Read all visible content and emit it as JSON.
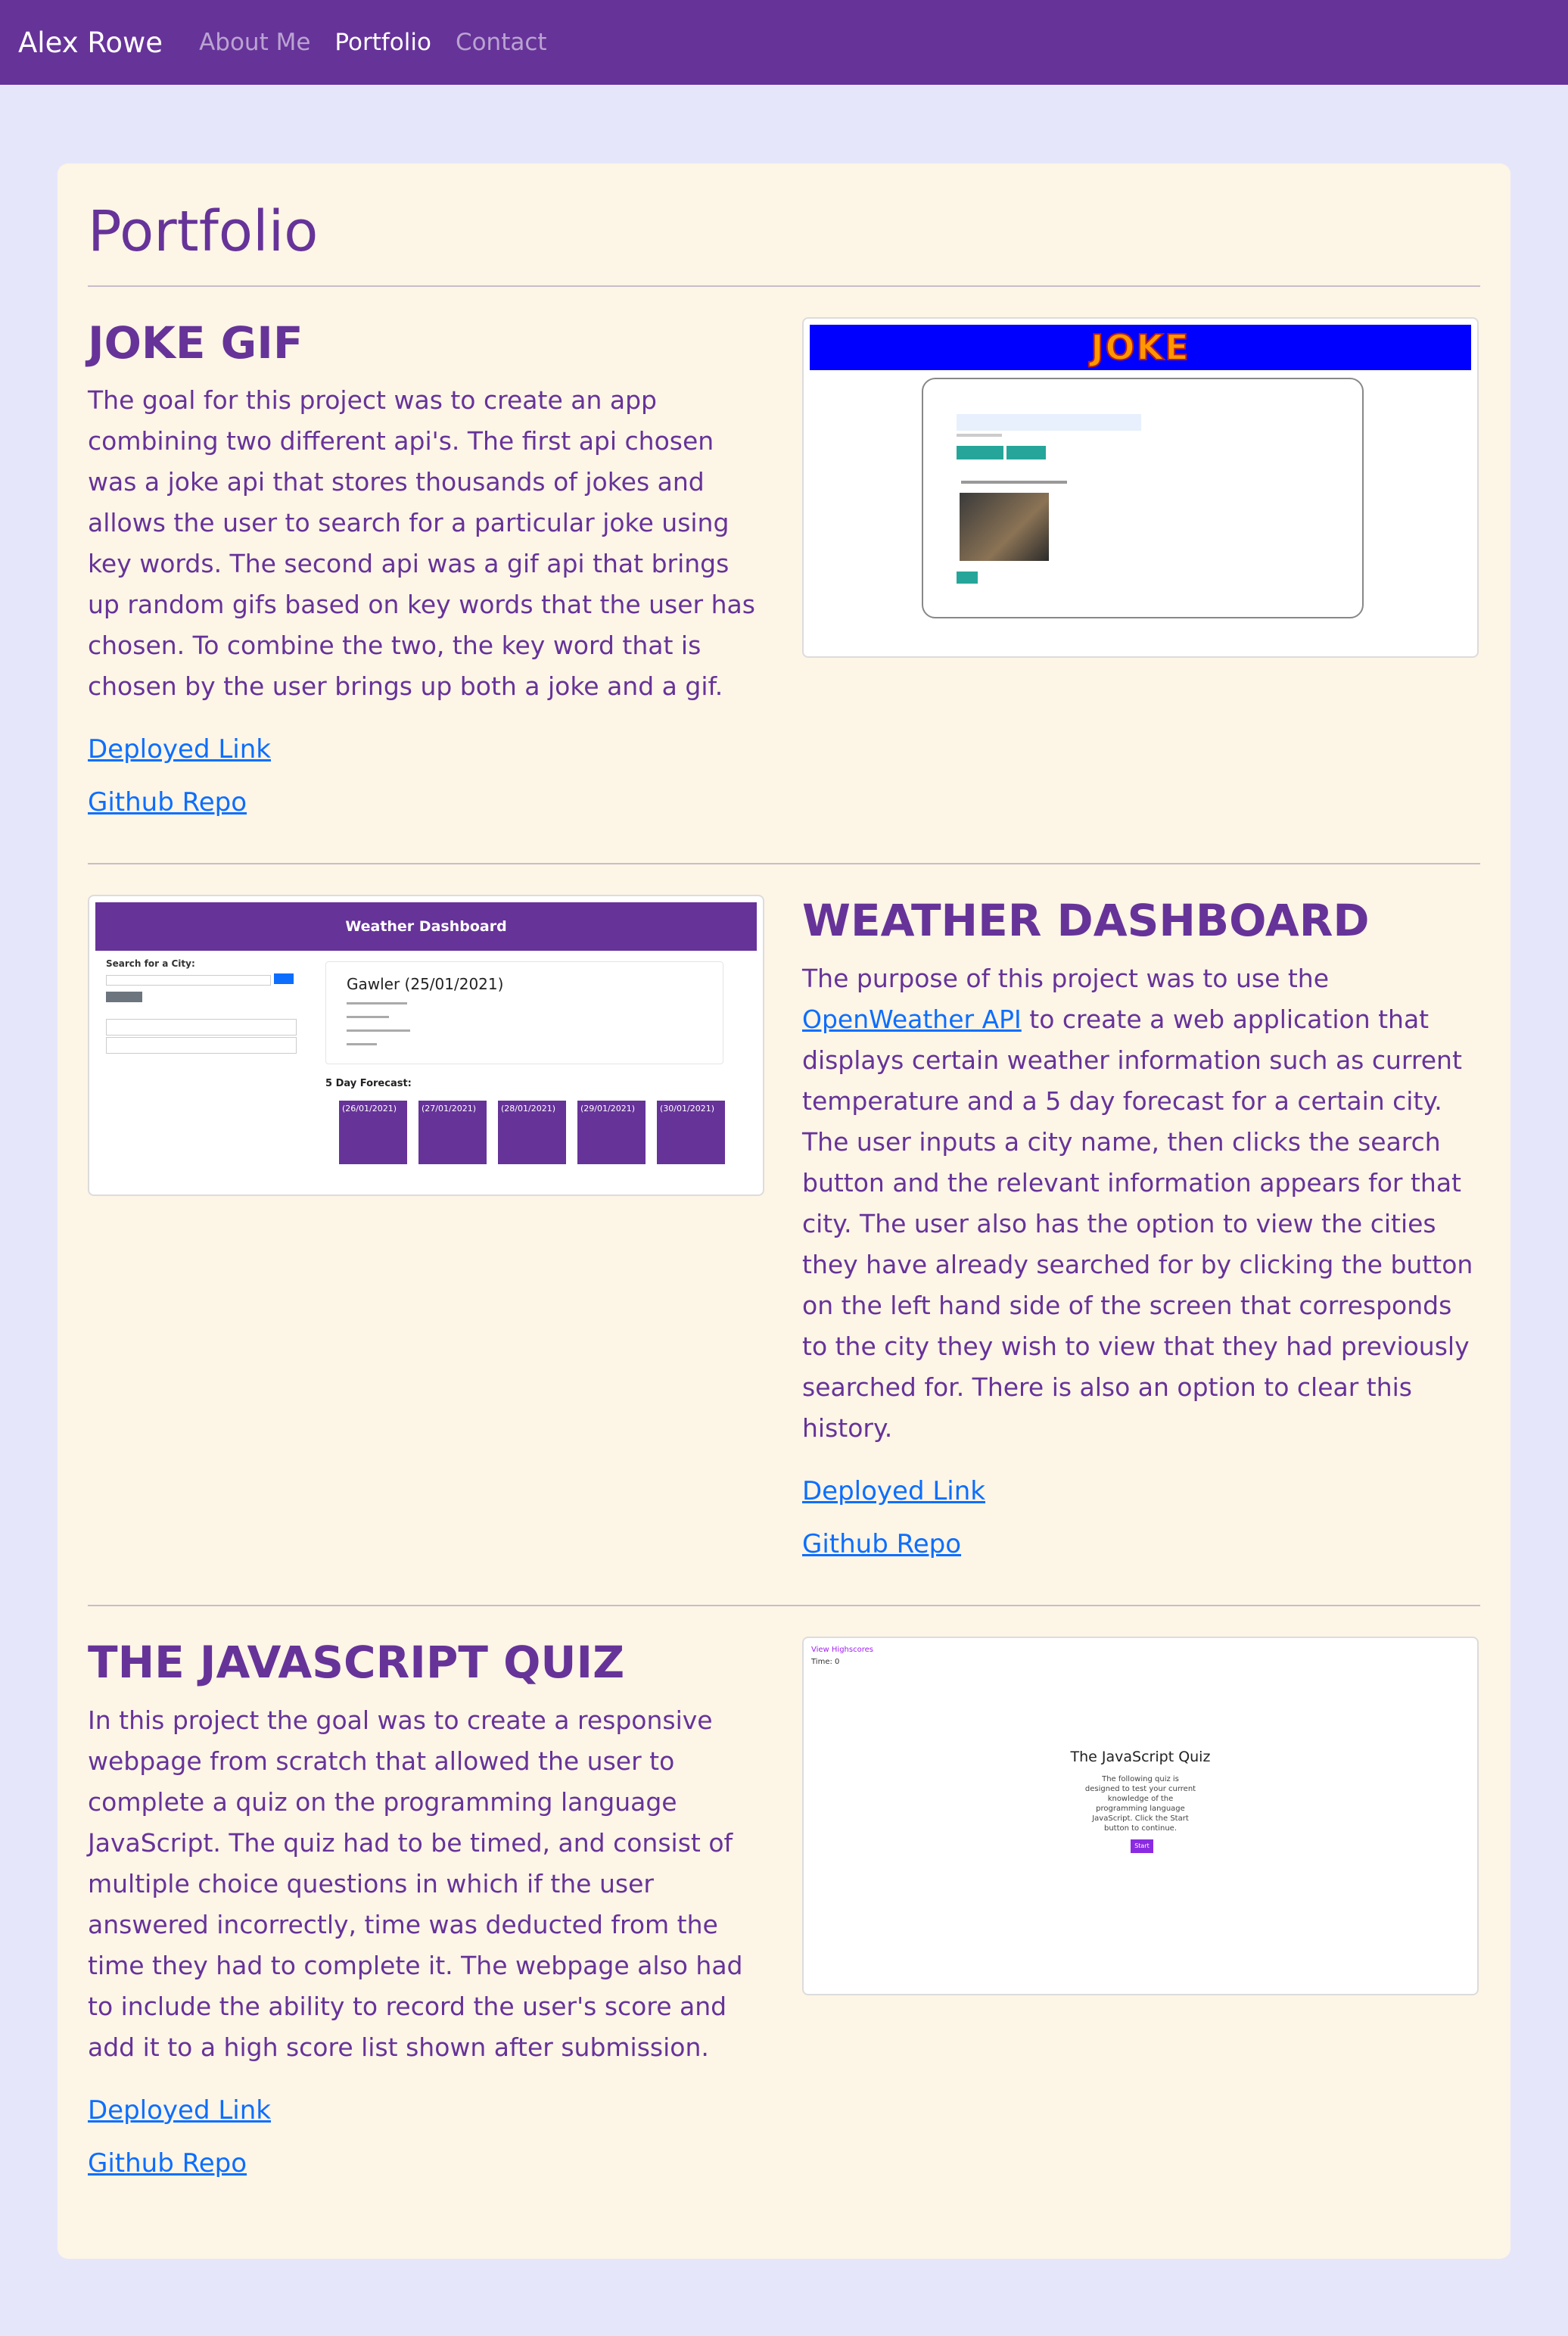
{
  "nav": {
    "brand": "Alex Rowe",
    "links": [
      "About Me",
      "Portfolio",
      "Contact"
    ]
  },
  "page": {
    "title": "Portfolio"
  },
  "projects": [
    {
      "title": "JOKE GIF",
      "description": "The goal for this project was to create an app combining two different api's. The first api chosen was a joke api that stores thousands of jokes and allows the user to search for a particular joke using key words. The second api was a gif api that brings up random gifs based on key words that the user has chosen. To combine the two, the key word that is chosen by the user brings up both a joke and a gif.",
      "deployed_label": "Deployed Link",
      "repo_label": "Github Repo",
      "thumbnail": {
        "banner": "JOKE"
      }
    },
    {
      "title": "WEATHER DASHBOARD",
      "description_prefix": "The purpose of this project was to use the ",
      "api_link": "OpenWeather API",
      "description_suffix": " to create a web application that displays certain weather information such as current temperature and a 5 day forecast for a certain city. The user inputs a city name, then clicks the search button and the relevant information appears for that city. The user also has the option to view the cities they have already searched for by clicking the button on the left hand side of the screen that corresponds to the city they wish to view that they had previously searched for. There is also an option to clear this history.",
      "deployed_label": "Deployed Link",
      "repo_label": "Github Repo",
      "thumbnail": {
        "header": "Weather Dashboard",
        "search_label": "Search for a City:",
        "city": "Gawler (25/01/2021)",
        "forecast_title": "5 Day Forecast:",
        "forecast_dates": [
          "(26/01/2021)",
          "(27/01/2021)",
          "(28/01/2021)",
          "(29/01/2021)",
          "(30/01/2021)"
        ]
      }
    },
    {
      "title": "THE JAVASCRIPT QUIZ",
      "description": "In this project the goal was to create a responsive webpage from scratch that allowed the user to complete a quiz on the programming language JavaScript. The quiz had to be timed, and consist of multiple choice questions in which if the user answered incorrectly, time was deducted from the time they had to complete it. The webpage also had to include the ability to record the user's score and add it to a high score list shown after submission.",
      "deployed_label": "Deployed Link",
      "repo_label": "Github Repo",
      "thumbnail": {
        "highscores": "View Highscores",
        "time": "Time: 0",
        "title": "The JavaScript Quiz",
        "description": "The following quiz is designed to test your current knowledge of the programming language JavaScript. Click the Start button to continue.",
        "start": "Start"
      }
    }
  ],
  "colors": {
    "nav": "#663399",
    "background": "#e6e6fa",
    "card": "#fdf5e6",
    "text": "#663399",
    "link": "#0d6efd"
  }
}
